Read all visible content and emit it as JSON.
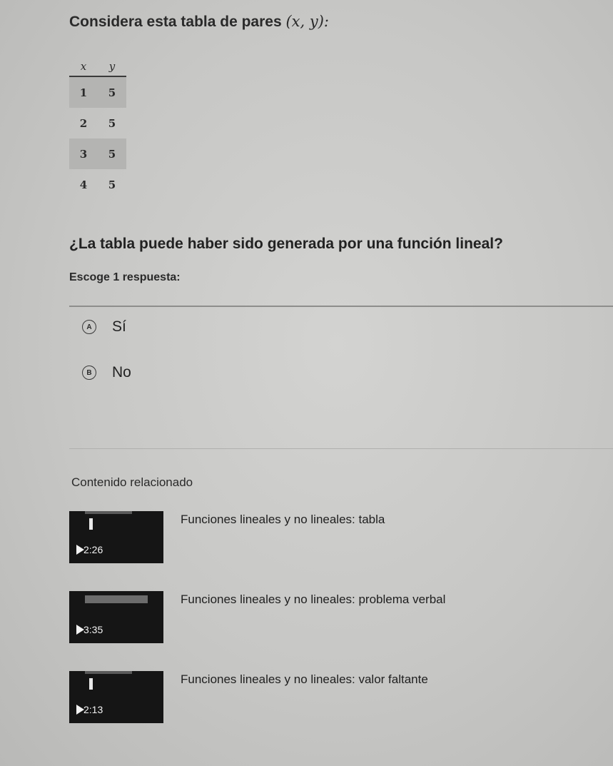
{
  "question": {
    "header_text": "Considera esta tabla de pares",
    "header_math": "(x, y):",
    "table": {
      "headers": [
        "x",
        "y"
      ],
      "rows": [
        [
          "1",
          "5"
        ],
        [
          "2",
          "5"
        ],
        [
          "3",
          "5"
        ],
        [
          "4",
          "5"
        ]
      ]
    },
    "prompt": "¿La tabla puede haber sido generada por una función lineal?",
    "instructions": "Escoge 1 respuesta:",
    "choices": [
      {
        "letter": "A",
        "text": "Sí"
      },
      {
        "letter": "B",
        "text": "No"
      }
    ]
  },
  "related": {
    "title": "Contenido relacionado",
    "videos": [
      {
        "title": "Funciones lineales y no lineales: tabla",
        "duration": "2:26"
      },
      {
        "title": "Funciones lineales y no lineales: problema verbal",
        "duration": "3:35"
      },
      {
        "title": "Funciones lineales y no lineales: valor faltante",
        "duration": "2:13"
      }
    ]
  },
  "colors": {
    "background": "#c9c9c7",
    "thumbnail": "#151515"
  },
  "icons": {
    "video_play": "play-icon"
  }
}
